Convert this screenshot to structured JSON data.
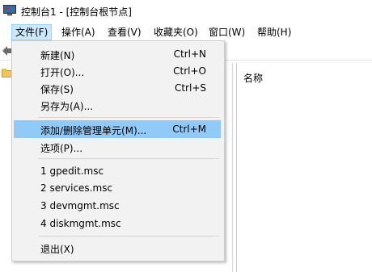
{
  "window": {
    "title": "控制台1 - [控制台根节点]",
    "icon": "mmc-console-icon"
  },
  "menubar": {
    "items": [
      {
        "label": "文件(F)",
        "active": true
      },
      {
        "label": "操作(A)"
      },
      {
        "label": "查看(V)"
      },
      {
        "label": "收藏夹(O)"
      },
      {
        "label": "窗口(W)"
      },
      {
        "label": "帮助(H)"
      }
    ]
  },
  "toolbar": {
    "back_icon": "back-arrow-icon"
  },
  "tree": {
    "icon": "folder-icon"
  },
  "list": {
    "column_header": "名称"
  },
  "file_menu": {
    "items": [
      {
        "label": "新建(N)",
        "shortcut": "Ctrl+N"
      },
      {
        "label": "打开(O)...",
        "shortcut": "Ctrl+O"
      },
      {
        "label": "保存(S)",
        "shortcut": "Ctrl+S"
      },
      {
        "label": "另存为(A)...",
        "shortcut": ""
      },
      {
        "label": "添加/删除管理单元(M)...",
        "shortcut": "Ctrl+M",
        "highlighted": true
      },
      {
        "label": "选项(P)...",
        "shortcut": ""
      },
      {
        "label": "1 gpedit.msc",
        "shortcut": ""
      },
      {
        "label": "2 services.msc",
        "shortcut": ""
      },
      {
        "label": "3 devmgmt.msc",
        "shortcut": ""
      },
      {
        "label": "4 diskmgmt.msc",
        "shortcut": ""
      },
      {
        "label": "退出(X)",
        "shortcut": ""
      }
    ]
  },
  "colors": {
    "highlight": "#91c9f7",
    "menu_bg": "#f2f2f2",
    "active_menu": "#cce8ff"
  }
}
